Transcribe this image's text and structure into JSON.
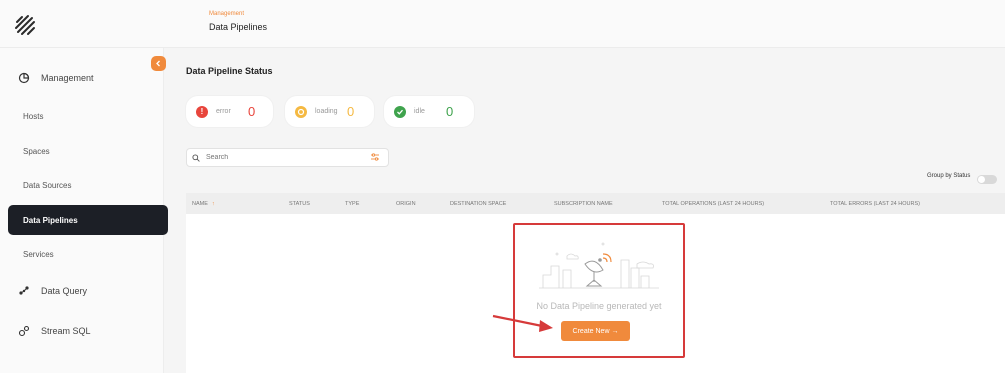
{
  "sidebar": {
    "logo_icon": "diagonal-stripes-logo",
    "items": [
      {
        "label": "Management",
        "icon": "dashboard-gauge-icon"
      },
      {
        "label": "Hosts"
      },
      {
        "label": "Spaces"
      },
      {
        "label": "Data Sources"
      },
      {
        "label": "Data Pipelines",
        "active": true
      },
      {
        "label": "Services"
      },
      {
        "label": "Data Query",
        "icon": "query-icon"
      },
      {
        "label": "Stream SQL",
        "icon": "stream-sql-icon"
      }
    ]
  },
  "header": {
    "breadcrumb": "Management",
    "title": "Data Pipelines"
  },
  "status": {
    "title": "Data Pipeline Status",
    "cards": [
      {
        "label": "error",
        "count": "0",
        "color": "#e8453c",
        "icon": "exclamation-icon"
      },
      {
        "label": "loading",
        "count": "0",
        "color": "#f5b942",
        "icon": "loading-icon"
      },
      {
        "label": "idle",
        "count": "0",
        "color": "#3fa34d",
        "icon": "check-icon"
      }
    ]
  },
  "search": {
    "placeholder": "Search",
    "icon": "search-icon",
    "filter_icon": "filter-sliders-icon"
  },
  "group_by": {
    "label": "Group by Status",
    "enabled": false
  },
  "table": {
    "columns": [
      "NAME",
      "STATUS",
      "TYPE",
      "ORIGIN",
      "DESTINATION SPACE",
      "SUBSCRIPTION NAME",
      "TOTAL OPERATIONS (LAST 24 HOURS)",
      "TOTAL ERRORS (LAST 24 HOURS)"
    ],
    "sort_icon": "sort-up-arrow"
  },
  "empty": {
    "message": "No Data Pipeline generated yet",
    "button": "Create New  →",
    "illustration": "satellite-dish-city-illustration"
  },
  "colors": {
    "accent": "#f08a3c",
    "annotation": "#d63a3a",
    "sidebar_active": "#1c1f26"
  }
}
